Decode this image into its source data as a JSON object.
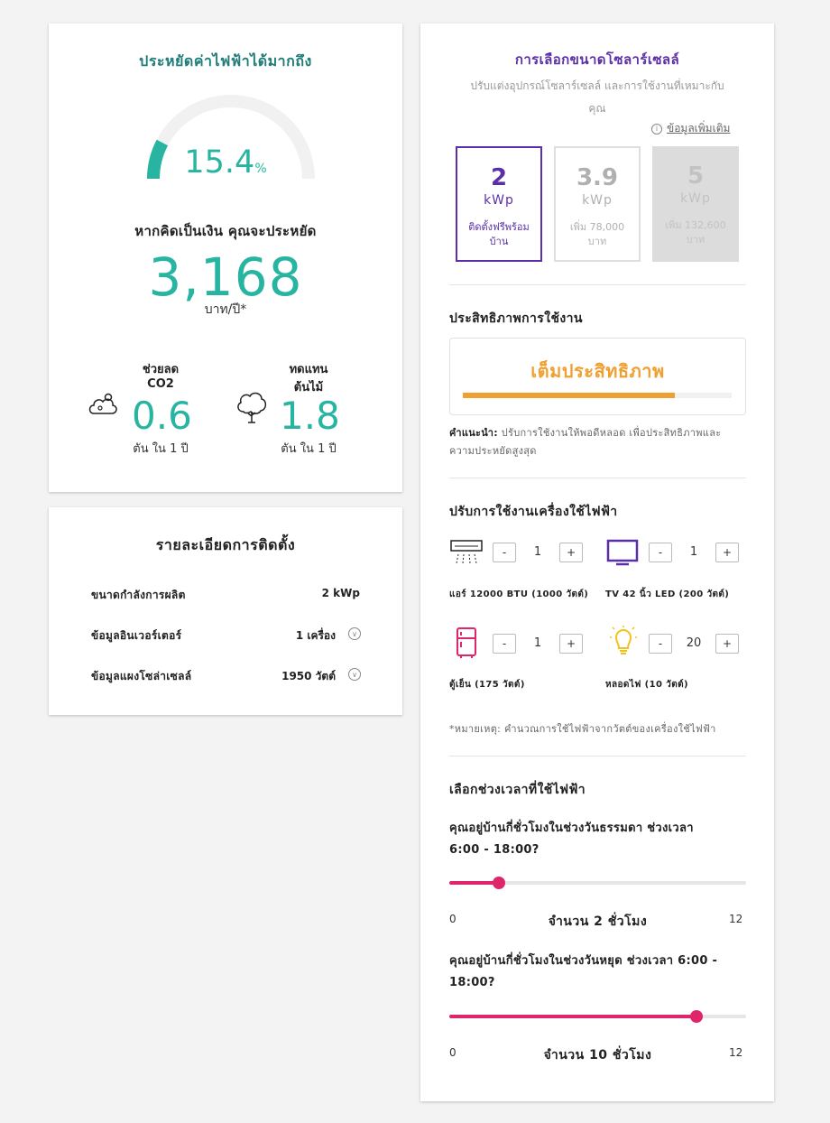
{
  "savings": {
    "title": "ประหยัดค่าไฟฟ้าได้มากถึง",
    "percent": "15.4",
    "percent_unit": "%",
    "percent_value": 15.4,
    "money_label": "หากคิดเป็นเงิน คุณจะประหยัด",
    "money_value": "3,168",
    "money_unit": "บาท/ปี*",
    "co2": {
      "label_line1": "ช่วยลด",
      "label_line2": "CO2",
      "value": "0.6",
      "unit": "ตัน ใน 1 ปี",
      "icon": "co2-cloud-icon"
    },
    "trees": {
      "label_line1": "ทดแทน",
      "label_line2": "ต้นไม้",
      "value": "1.8",
      "unit": "ตัน ใน 1 ปี",
      "icon": "tree-icon"
    },
    "colors": {
      "accent": "#27b5a2",
      "gauge_track": "#f1f1f1"
    }
  },
  "install": {
    "title": "รายละเอียดการติดตั้ง",
    "rows": [
      {
        "label": "ขนาดกำลังการผลิต",
        "value": "2 kWp"
      },
      {
        "label": "ข้อมูลอินเวอร์เตอร์",
        "value": "1 เครื่อง"
      },
      {
        "label": "ข้อมูลแผงโซล่าเซลล์",
        "value": "1950 วัตต์"
      }
    ]
  },
  "sizing": {
    "title": "การเลือกขนาดโซลาร์เซลล์",
    "subtitle_line1": "ปรับแต่งอุปกรณ์โซลาร์เซลล์ และการใช้งานที่เหมาะกับ",
    "subtitle_line2": "คุณ",
    "more_info": "ข้อมูลเพิ่มเติม",
    "options": [
      {
        "size": "2",
        "unit": "kWp",
        "line1": "ติดตั้งฟรีพร้อม",
        "line2": "บ้าน",
        "state": "selected"
      },
      {
        "size": "3.9",
        "unit": "kWp",
        "line1": "เพิ่ม 78,000",
        "line2": "บาท",
        "state": "available"
      },
      {
        "size": "5",
        "unit": "kWp",
        "line1": "เพิ่ม 132,600",
        "line2": "บาท",
        "state": "disabled"
      }
    ],
    "colors": {
      "primary": "#5b2fa8"
    }
  },
  "efficiency": {
    "title": "ประสิทธิภาพการใช้งาน",
    "status": "เต็มประสิทธิภาพ",
    "level": 0.79,
    "advice_label": "คำแนะนำ:",
    "advice_text_line1": " ปรับการใช้งานให้พอดีหลอด เพื่อประสิทธิภาพและ",
    "advice_text_line2": "ความประหยัดสูงสุด",
    "colors": {
      "bar": "#f0a030"
    }
  },
  "appliances": {
    "title": "ปรับการใช้งานเครื่องใช้ไฟฟ้า",
    "items": [
      {
        "label": "แอร์ 12000 BTU (1000 วัตต์)",
        "count": "1",
        "icon": "air-conditioner-icon"
      },
      {
        "label": "TV 42 นิ้ว LED (200 วัตต์)",
        "count": "1",
        "icon": "tv-icon"
      },
      {
        "label": "ตู้เย็น (175 วัตต์)",
        "count": "1",
        "icon": "fridge-icon"
      },
      {
        "label": "หลอดไฟ (10 วัตต์)",
        "count": "20",
        "icon": "lightbulb-icon"
      }
    ],
    "minus": "-",
    "plus": "+",
    "note": "*หมายเหตุ: คำนวณการใช้ไฟฟ้าจากวัตต์ของเครื่องใช้ไฟฟ้า"
  },
  "time": {
    "title": "เลือกช่วงเวลาที่ใช้ไฟฟ้า",
    "weekday": {
      "question_line1": "คุณอยู่บ้านกี่ชั่วโมงในช่วงวันธรรมดา ช่วงเวลา",
      "question_line2": "6:00 - 18:00?",
      "min": "0",
      "max": "12",
      "value": 2,
      "hours_label": "จำนวน 2 ชั่วโมง"
    },
    "weekend": {
      "question_line1": "คุณอยู่บ้านกี่ชั่วโมงในช่วงวันหยุด ช่วงเวลา 6:00 -",
      "question_line2": "18:00?",
      "min": "0",
      "max": "12",
      "value": 10,
      "hours_label": "จำนวน 10 ชั่วโมง"
    },
    "colors": {
      "slider": "#e0266b"
    }
  }
}
